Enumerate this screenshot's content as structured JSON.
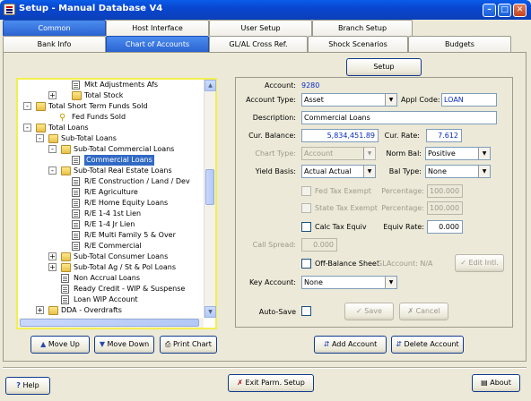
{
  "window": {
    "title": "Setup - Manual Database V4"
  },
  "top_tabs": [
    "Common",
    "Host Interface",
    "User Setup",
    "Branch Setup"
  ],
  "sub_tabs": [
    "Bank Info",
    "Chart of Accounts",
    "GL/AL Cross Ref.",
    "Shock Scenarios",
    "Budgets"
  ],
  "tree": [
    "Mkt Adjustments Afs",
    "Total Stock",
    "Total Short Term Funds Sold",
    "Fed Funds Sold",
    "Total Loans",
    "Sub-Total Loans",
    "Sub-Total Commercial Loans",
    "Commercial Loans",
    "Sub-Total Real Estate Loans",
    "R/E Construction / Land / Dev",
    "R/E Agriculture",
    "R/E Home Equity Loans",
    "R/E 1-4 1st Lien",
    "R/E 1-4 Jr Lien",
    "R/E Multi Family 5 & Over",
    "R/E Commercial",
    "Sub-Total Consumer Loans",
    "Sub-Total Ag / St & Pol Loans",
    "Non Accrual Loans",
    "Ready Credit - WIP & Suspense",
    "Loan WIP Account",
    "DDA - Overdrafts"
  ],
  "buttons": {
    "setup": "Setup",
    "move_up": "Move Up",
    "move_down": "Move Down",
    "print_chart": "Print Chart",
    "add_account": "Add Account",
    "delete_account": "Delete Account",
    "help": "Help",
    "exit": "Exit Parm. Setup",
    "about": "About",
    "save": "Save",
    "cancel": "Cancel",
    "edit_intl": "Edit Intl."
  },
  "form": {
    "account_label": "Account:",
    "account_value": "9280",
    "account_type_label": "Account Type:",
    "account_type_value": "Asset",
    "appl_code_label": "Appl Code:",
    "appl_code_value": "LOAN",
    "description_label": "Description:",
    "description_value": "Commercial Loans",
    "cur_balance_label": "Cur. Balance:",
    "cur_balance_value": "5,834,451.89",
    "cur_rate_label": "Cur. Rate:",
    "cur_rate_value": "7.612",
    "chart_type_label": "Chart Type:",
    "chart_type_value": "Account",
    "norm_bal_label": "Norm Bal:",
    "norm_bal_value": "Positive",
    "yield_basis_label": "Yield Basis:",
    "yield_basis_value": "Actual Actual",
    "bal_type_label": "Bal Type:",
    "bal_type_value": "None",
    "fed_tax_label": "Fed Tax Exempt",
    "state_tax_label": "State Tax Exempt",
    "percentage_label": "Percentage:",
    "fed_pct": "100.000",
    "state_pct": "100.000",
    "calc_tax_label": "Calc Tax Equiv",
    "equiv_rate_label": "Equiv Rate:",
    "equiv_rate_value": "0.000",
    "call_spread_label": "Call Spread:",
    "call_spread_value": "0.000",
    "off_balance_label": "Off-Balance Sheet",
    "glaccount_label": "GLAccount: N/A",
    "key_account_label": "Key Account:",
    "key_account_value": "None",
    "auto_save_label": "Auto-Save"
  },
  "colors": {
    "title_bar": "#0a5ce8",
    "selected_tab": "#3a78e6",
    "tree_border": "#f3ef52",
    "value_blue": "#0a2cc0"
  }
}
